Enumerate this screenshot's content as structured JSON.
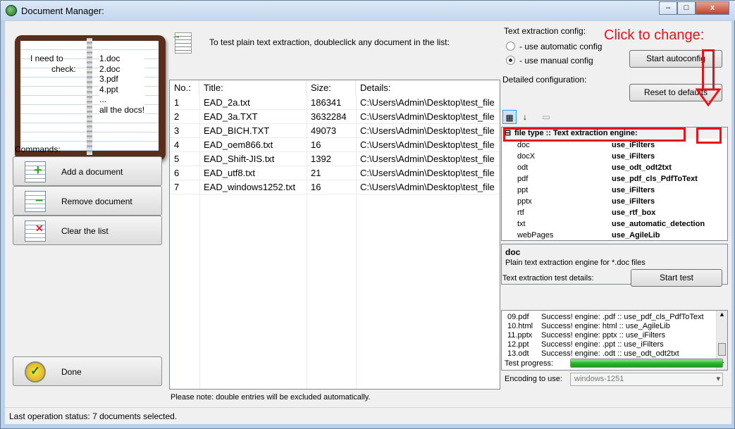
{
  "window": {
    "title": "Document Manager:",
    "min": "–",
    "max": "□",
    "close": "x"
  },
  "book": {
    "left_line1": "I need to",
    "left_line2": "check:",
    "right_lines": [
      "1.doc",
      "2.doc",
      "3.pdf",
      "4.ppt",
      "...",
      "all the docs!"
    ]
  },
  "commands": {
    "label": "Commands:",
    "add": "Add a document",
    "remove": "Remove document",
    "clear": "Clear the list",
    "done": "Done"
  },
  "hint": "To test plain text extraction, doubleclick any document in the list:",
  "list": {
    "columns": [
      "No.:",
      "Title:",
      "Size:",
      "Details:"
    ],
    "rows": [
      {
        "no": "1",
        "title": "EAD_2a.txt",
        "size": "186341",
        "details": "C:\\Users\\Admin\\Desktop\\test_file"
      },
      {
        "no": "2",
        "title": "EAD_3a.TXT",
        "size": "3632284",
        "details": "C:\\Users\\Admin\\Desktop\\test_file"
      },
      {
        "no": "3",
        "title": "EAD_BICH.TXT",
        "size": "49073",
        "details": "C:\\Users\\Admin\\Desktop\\test_file"
      },
      {
        "no": "4",
        "title": "EAD_oem866.txt",
        "size": "16",
        "details": "C:\\Users\\Admin\\Desktop\\test_file"
      },
      {
        "no": "5",
        "title": "EAD_Shift-JIS.txt",
        "size": "1392",
        "details": "C:\\Users\\Admin\\Desktop\\test_file"
      },
      {
        "no": "6",
        "title": "EAD_utf8.txt",
        "size": "21",
        "details": "C:\\Users\\Admin\\Desktop\\test_file"
      },
      {
        "no": "7",
        "title": "EAD_windows1252.txt",
        "size": "16",
        "details": "C:\\Users\\Admin\\Desktop\\test_file"
      }
    ]
  },
  "note": "Please note: double entries will be excluded automatically.",
  "status": "Last operation status:  7 documents selected.",
  "config": {
    "group_label": "Text extraction config:",
    "auto_label": "- use automatic config",
    "manual_label": "- use manual config",
    "selected": "manual",
    "start_autoconfig": "Start autoconfig",
    "detailed_label": "Detailed configuration:",
    "reset": "Reset to defaults",
    "category": "file type :: Text extraction engine:",
    "props": [
      {
        "k": "doc",
        "v": "use_iFilters"
      },
      {
        "k": "docX",
        "v": "use_iFilters"
      },
      {
        "k": "odt",
        "v": "use_odt_odt2txt"
      },
      {
        "k": "pdf",
        "v": "use_pdf_cls_PdfToText"
      },
      {
        "k": "ppt",
        "v": "use_iFilters"
      },
      {
        "k": "pptx",
        "v": "use_iFilters"
      },
      {
        "k": "rtf",
        "v": "use_rtf_box"
      },
      {
        "k": "txt",
        "v": "use_automatic_detection"
      },
      {
        "k": "webPages",
        "v": "use_AgileLib"
      }
    ],
    "desc_title": "doc",
    "desc_text": "Plain text extraction engine for *.doc files"
  },
  "test": {
    "label": "Text extraction test details:",
    "start": "Start test",
    "log": [
      {
        "n": "09.pdf",
        "t": "Success! engine: .pdf :: use_pdf_cls_PdfToText"
      },
      {
        "n": "10.html",
        "t": "Success! engine: html :: use_AgileLib"
      },
      {
        "n": "11.pptx",
        "t": "Success! engine: pptx :: use_iFilters"
      },
      {
        "n": "12.ppt",
        "t": "Success! engine: .ppt :: use_iFilters"
      },
      {
        "n": "13.odt",
        "t": "Success! engine: .odt :: use_odt_odt2txt"
      }
    ],
    "progress_label": "Test progress:",
    "progress": 1.0,
    "encoding_label": "Encoding to use:",
    "encoding": "windows-1251"
  },
  "annotation": {
    "text": "Click to change:",
    "color": "#e4141b"
  }
}
